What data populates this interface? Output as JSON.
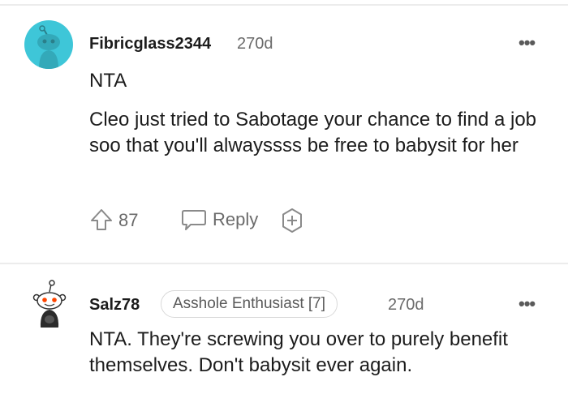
{
  "comments": [
    {
      "username": "Fibricglass2344",
      "age": "270d",
      "more_label": "•••",
      "paragraphs": [
        "NTA",
        "Cleo just tried to Sabotage your chance to find a job soo that you'll alwayssss be free to babysit for her"
      ],
      "upvotes": "87",
      "reply_label": "Reply",
      "avatar_icon": "snoo-avatar-icon",
      "upvote_icon": "upvote-arrow-icon",
      "reply_icon": "speech-bubble-icon",
      "award_icon": "add-award-icon"
    },
    {
      "username": "Salz78",
      "flair": "Asshole Enthusiast [7]",
      "age": "270d",
      "more_label": "•••",
      "paragraphs": [
        "NTA. They're screwing you over to purely benefit themselves. Don't babysit ever again."
      ],
      "avatar_icon": "snoo-avatar-icon"
    }
  ],
  "colors": {
    "avatar_bg": "#3ec6d8",
    "text": "#1c1c1c",
    "muted": "#6b6b6b",
    "divider": "#ececec"
  }
}
